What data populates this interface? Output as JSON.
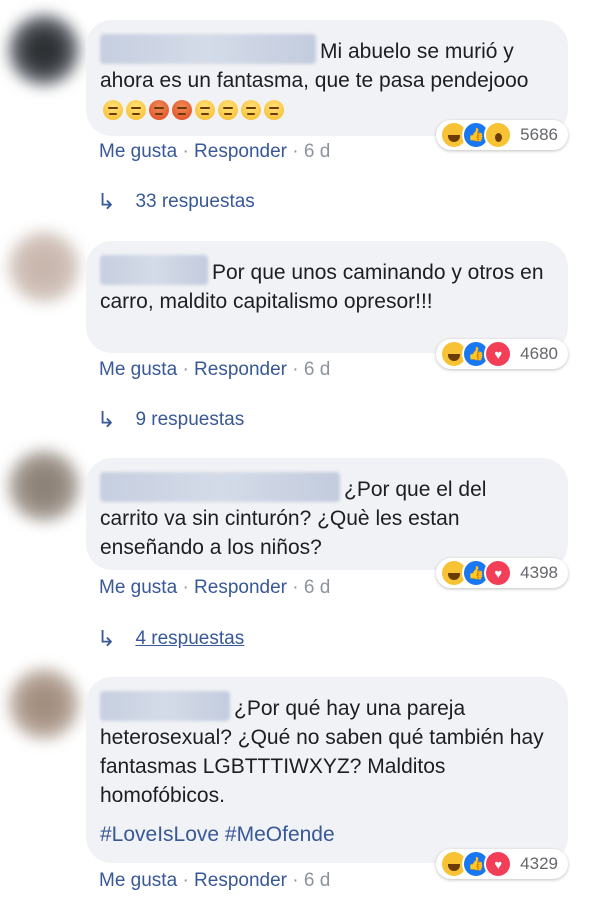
{
  "comments": [
    {
      "text": "Mi abuelo se murió y ahora es un fantasma, que te pasa pendejooo",
      "emojis": [
        "steam-face",
        "steam-face",
        "angry-face",
        "angry-face",
        "unamused-face",
        "unamused-face",
        "unamused-face",
        "unamused-face"
      ],
      "reactions": [
        "haha",
        "like",
        "wow"
      ],
      "reaction_count": "5686",
      "like": "Me gusta",
      "reply": "Responder",
      "time": "6 d",
      "replies": "33 respuestas"
    },
    {
      "text": "Por que unos caminando y otros en carro, maldito capitalismo opresor!!!",
      "reactions": [
        "haha",
        "like",
        "love"
      ],
      "reaction_count": "4680",
      "like": "Me gusta",
      "reply": "Responder",
      "time": "6 d",
      "replies": "9 respuestas"
    },
    {
      "text": "¿Por que el del carrito va sin cinturón? ¿Què les estan enseñando a los niños?",
      "reactions": [
        "haha",
        "like",
        "love"
      ],
      "reaction_count": "4398",
      "like": "Me gusta",
      "reply": "Responder",
      "time": "6 d",
      "replies": "4 respuestas"
    },
    {
      "text": "¿Por qué hay una pareja heterosexual? ¿Qué no saben qué también hay fantasmas LGBTTTIWXYZ? Malditos homofóbicos.",
      "hashtags": "#LoveIsLove #MeOfende",
      "reactions": [
        "haha",
        "like",
        "love"
      ],
      "reaction_count": "4329",
      "like": "Me gusta",
      "reply": "Responder",
      "time": "6 d"
    }
  ],
  "separator": "·",
  "colors": {
    "link": "#385898",
    "bubble": "#f1f2f5",
    "meta": "#8d949e"
  }
}
